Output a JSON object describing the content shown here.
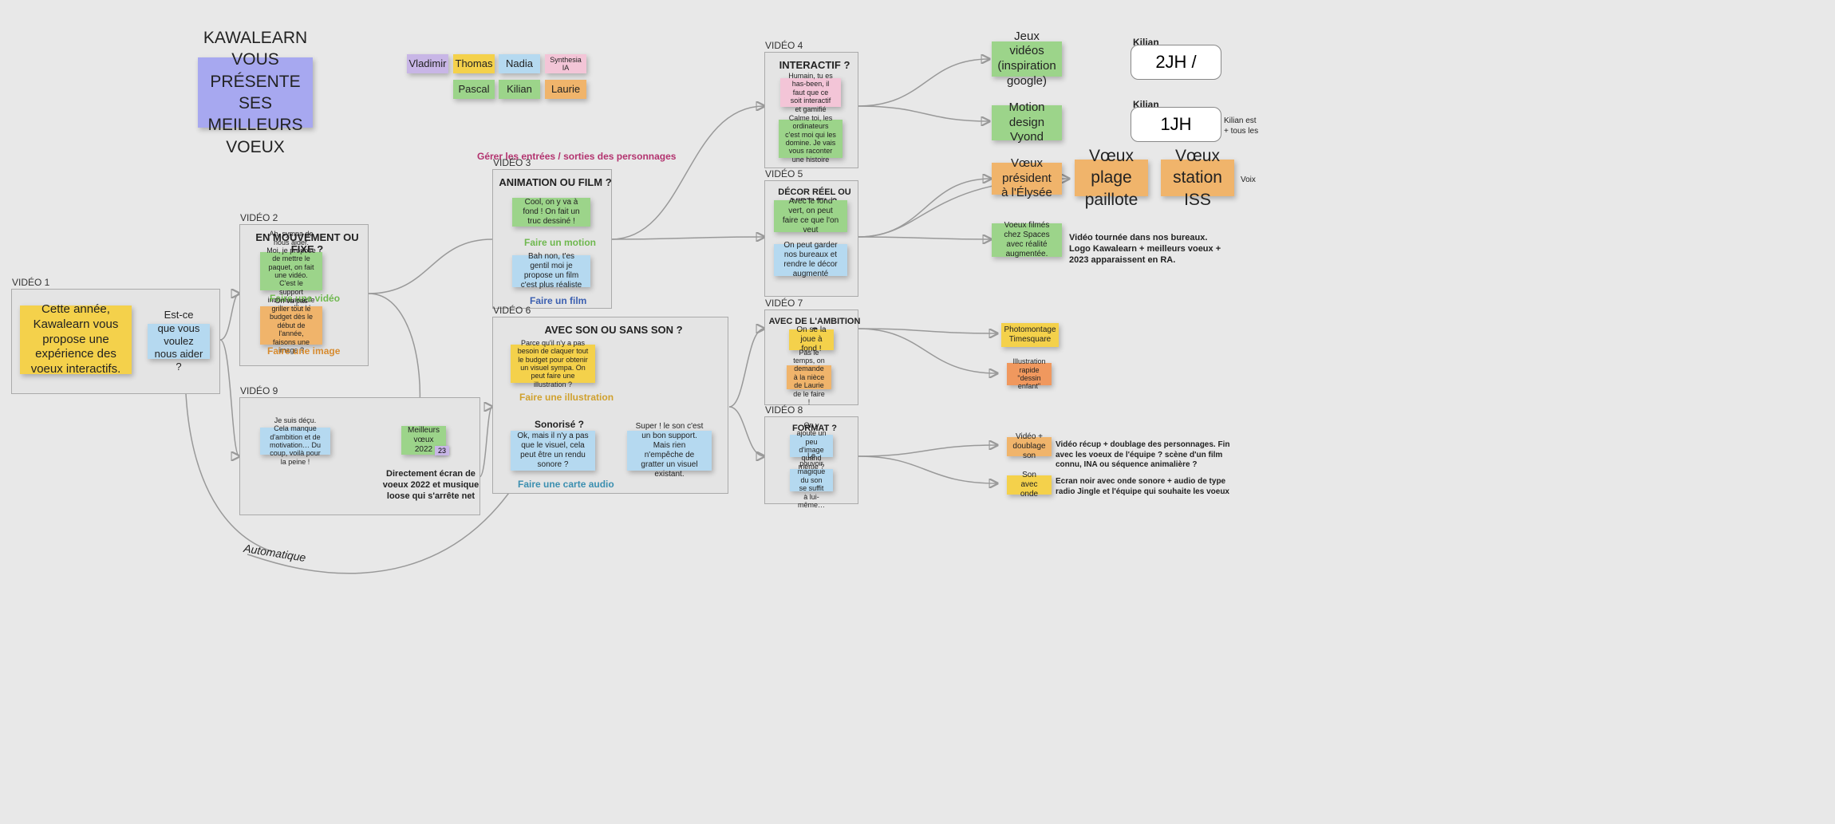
{
  "title": "KAWALEARN VOUS PRÉSENTE SES MEILLEURS VOEUX",
  "people": [
    "Vladimir",
    "Thomas",
    "Nadia",
    "Synthesia IA",
    "Pascal",
    "Kilian",
    "Laurie"
  ],
  "labels": {
    "auto": "Automatique",
    "kilian": "Kilian"
  },
  "frames": {
    "v1": {
      "label": "VIDÉO 1",
      "note1": "Cette année, Kawalearn vous propose une expérience des voeux interactifs.",
      "note2": "Est-ce que vous voulez nous aider ?"
    },
    "v2": {
      "label": "VIDÉO 2",
      "title": "EN MOUVEMENT OU FIXE ?",
      "note1": "Ah, sympa de nous aider. Moi, je propose de mettre le paquet, on fait une vidéo. C'est le support incontournable aujourd'hui !",
      "cap1": "Faire une vidéo",
      "note2": "On va pas griller tout le budget dès le début de l'année, faisons une image ?",
      "cap2": "Faire une image"
    },
    "v3": {
      "label": "VIDÉO 3",
      "hint": "Gérer les entrées / sorties des personnages",
      "title": "ANIMATION OU FILM ?",
      "note1": "Cool, on y va à fond ! On fait un truc dessiné !",
      "cap1": "Faire un motion",
      "note2": "Bah non, t'es gentil moi je propose un film c'est plus réaliste",
      "cap2": "Faire un film"
    },
    "v4": {
      "label": "VIDÉO 4",
      "title": "INTERACTIF ?",
      "note1": "Humain, tu es has-been, il faut que ce soit interactif et gamifié",
      "note2": "Calme toi, les ordinateurs c'est moi qui les domine. Je vais vous raconter une histoire"
    },
    "v5": {
      "label": "VIDÉO 5",
      "title": "DÉCOR RÉEL OU VIRTUEL ?",
      "note1": "Avec le fond vert, on peut faire ce que l'on veut",
      "note2": "On peut garder nos bureaux et rendre le décor augmenté"
    },
    "v6": {
      "label": "VIDÉO 6",
      "title": "AVEC SON OU SANS SON ?",
      "note1": "Parce qu'il n'y a pas besoin de claquer tout le budget pour obtenir un visuel sympa. On peut faire une illustration ?",
      "cap1": "Faire une illustration",
      "sub": "Sonorisé ?",
      "note2": "Ok, mais il n'y a pas que le visuel, cela peut être un rendu sonore ?",
      "note3": "Super ! le son c'est un bon support. Mais rien n'empêche de gratter un visuel existant.",
      "cap2": "Faire une carte audio"
    },
    "v7": {
      "label": "VIDÉO 7",
      "title": "AVEC DE L'AMBITION ?",
      "note1": "On se la joue à fond !",
      "note2": "Pas le temps, on demande à la nièce de Laurie de le faire !"
    },
    "v8": {
      "label": "VIDÉO 8",
      "title": "FORMAT ?",
      "note1": "On y ajoute un peu d'image quand même ?",
      "note2": "Le pouvoir magique du son se suffit à lui-même…"
    },
    "v9": {
      "label": "VIDÉO 9",
      "note1": "Je suis déçu. Cela manque d'ambition et de motivation… Du coup, voilà pour la peine !",
      "note2": "Meilleurs vœux 2022",
      "tag": "23",
      "cap": "Directement écran de voeux 2022 et musique loose qui s'arrête net"
    }
  },
  "outputs": {
    "jeux": "Jeux vidéos (inspiration google)",
    "motion": "Motion design Vyond",
    "jh2": "2JH /",
    "jh1": "1JH",
    "kilianest": "Kilian est + tous les",
    "elysee": "Vœux président à l'Élysée",
    "plage": "Vœux plage paillote",
    "iss": "Vœux station ISS",
    "voix": "Voix",
    "ra": "Voeux filmés chez Spaces avec réalité augmentée.",
    "ra_desc": "Vidéo tournée dans nos bureaux. Logo Kawalearn + meilleurs voeux + 2023 apparaissent en RA.",
    "times": "Photomontage Timesquare",
    "ill": "Illustration rapide \"dessin enfant\"",
    "doub": "Vidéo + doublage son",
    "doub_desc": "Vidéo récup + doublage des personnages. Fin avec les voeux de l'équipe ? scène d'un film connu, INA ou séquence animalière ?",
    "onde": "Son avec onde",
    "onde_desc": "Ecran noir avec onde sonore + audio de type radio Jingle et l'équipe qui souhaite les voeux"
  }
}
